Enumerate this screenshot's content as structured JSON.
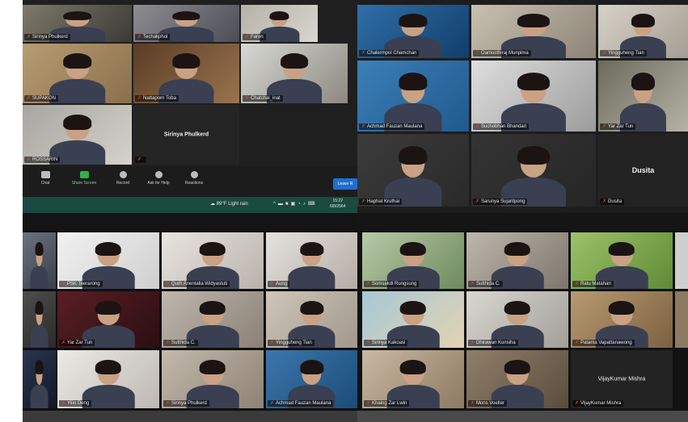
{
  "top_left": {
    "tiles": [
      {
        "name": "Sirinya Phulkerd",
        "colors": [
          "#7d7a6a",
          "#3b3a36"
        ]
      },
      {
        "name": "Techakphol",
        "colors": [
          "#8d8d92",
          "#4c4d56"
        ]
      },
      {
        "name": "Faron",
        "colors": [
          "#b6b1a8",
          "#d9d6d0"
        ]
      },
      {
        "name": "SUPAKON",
        "colors": [
          "#b89c72",
          "#8a6f4c"
        ]
      },
      {
        "name": "Nattaporn Toba",
        "colors": [
          "#5b3d25",
          "#9a7350"
        ]
      },
      {
        "name": "Chatchai_inat",
        "colors": [
          "#d8d8d4",
          "#8b8980"
        ]
      },
      {
        "name": "ROSSARIN",
        "colors": [
          "#a6a59f",
          "#d4d2cb"
        ]
      }
    ],
    "name_only_tile": "Sirinya Phulkerd",
    "toolbar": [
      {
        "label": "Chat",
        "icon": "chat-icon"
      },
      {
        "label": "Share Screen",
        "icon": "share-screen-icon"
      },
      {
        "label": "Record",
        "icon": "record-icon"
      },
      {
        "label": "Ask for Help",
        "icon": "help-icon"
      },
      {
        "label": "Reactions",
        "icon": "reactions-icon"
      }
    ],
    "leave_label": "Leave R",
    "weather": "89°F Light rain",
    "clock_time": "15:22",
    "clock_date": "6/8/2564"
  },
  "top_right": {
    "tiles": [
      {
        "name": "Chalermpol Chamchan",
        "colors": [
          "#2f6fa8",
          "#123e6b"
        ]
      },
      {
        "name": "Oamucthiraj Munpima",
        "colors": [
          "#c8c0b0",
          "#8d8477"
        ]
      },
      {
        "name": "Yingguheng Tian",
        "colors": [
          "#d7d2c8",
          "#a49d92"
        ]
      },
      {
        "name": "Achmad Fauzan Maulana",
        "colors": [
          "#3d7fb8",
          "#1f5a8c"
        ]
      },
      {
        "name": "Suchobhan Bhandari",
        "colors": [
          "#dedede",
          "#9c9c9c"
        ]
      },
      {
        "name": "Yar Zar Tun",
        "colors": [
          "#6b6b5e",
          "#b5b3a6"
        ]
      },
      {
        "name": "Haphat Kruthai",
        "colors": [
          "#3b3b3b",
          "#2a2a2a"
        ]
      },
      {
        "name": "Sarunya Sujaritpong",
        "colors": [
          "#343434",
          "#262626"
        ]
      },
      {
        "name": "Dusita",
        "colors": [
          "#262626",
          "#262626"
        ]
      }
    ],
    "dusita_big": "Dusita"
  },
  "bottom_left": {
    "tiles": [
      {
        "name": "",
        "colors": [
          "#6b7280",
          "#3a3f4a"
        ]
      },
      {
        "name": "PSK Teerarong",
        "colors": [
          "#f1f1f1",
          "#cfcfcf"
        ]
      },
      {
        "name": "Qurh Anentalia Widyastuti",
        "colors": [
          "#e8e4e0",
          "#b9b2ac"
        ]
      },
      {
        "name": "Aung",
        "colors": [
          "#e5e2de",
          "#b4ada5"
        ]
      },
      {
        "name": "",
        "colors": [
          "#4e4e4e",
          "#2a2a2a"
        ]
      },
      {
        "name": "Yar Zar Tun",
        "colors": [
          "#5a1e24",
          "#2a0f12"
        ]
      },
      {
        "name": "Sutthida C.",
        "colors": [
          "#bfb7ae",
          "#8a8076"
        ]
      },
      {
        "name": "Yingguheng Tian",
        "colors": [
          "#cfc6ba",
          "#a1978b"
        ]
      },
      {
        "name": "",
        "colors": [
          "#2b3550",
          "#111827"
        ]
      },
      {
        "name": "Yilin Deng",
        "colors": [
          "#eceae6",
          "#bdb8b2"
        ]
      },
      {
        "name": "Sirinya Phulkerd",
        "colors": [
          "#c2b9ac",
          "#8e8274"
        ]
      },
      {
        "name": "Achmad Fauzan Maulana",
        "colors": [
          "#3b77ad",
          "#1c4c78"
        ]
      }
    ]
  },
  "bottom_right": {
    "tiles": [
      {
        "name": "Somsakdi Rungsung",
        "colors": [
          "#b7c9a8",
          "#6f8a5d"
        ],
        "active": true
      },
      {
        "name": "Sutthida C.",
        "colors": [
          "#bdb6ad",
          "#7e766c"
        ]
      },
      {
        "name": "Ratu Matahari",
        "colors": [
          "#9cc26a",
          "#5f8a35"
        ]
      },
      {
        "name": "Sirinya Kakoasi",
        "colors": [
          "#a8c7d6",
          "#e2d3b3"
        ]
      },
      {
        "name": "Dhirawan Kunsiha",
        "colors": [
          "#d9d7d2",
          "#a29f98"
        ]
      },
      {
        "name": "Patama Vapattanawong",
        "colors": [
          "#b69a72",
          "#7c6141"
        ]
      },
      {
        "name": "Khaing Zar Lwin",
        "colors": [
          "#c9b8a2",
          "#8e7a63"
        ]
      },
      {
        "name": "Mons Voelter",
        "colors": [
          "#8f7f6a",
          "#5b4d3d"
        ]
      },
      {
        "name": "VijayKumar Mishra",
        "colors": [
          "#262626",
          "#262626"
        ]
      }
    ],
    "vijay_big": "VijayKumar Mishra"
  }
}
